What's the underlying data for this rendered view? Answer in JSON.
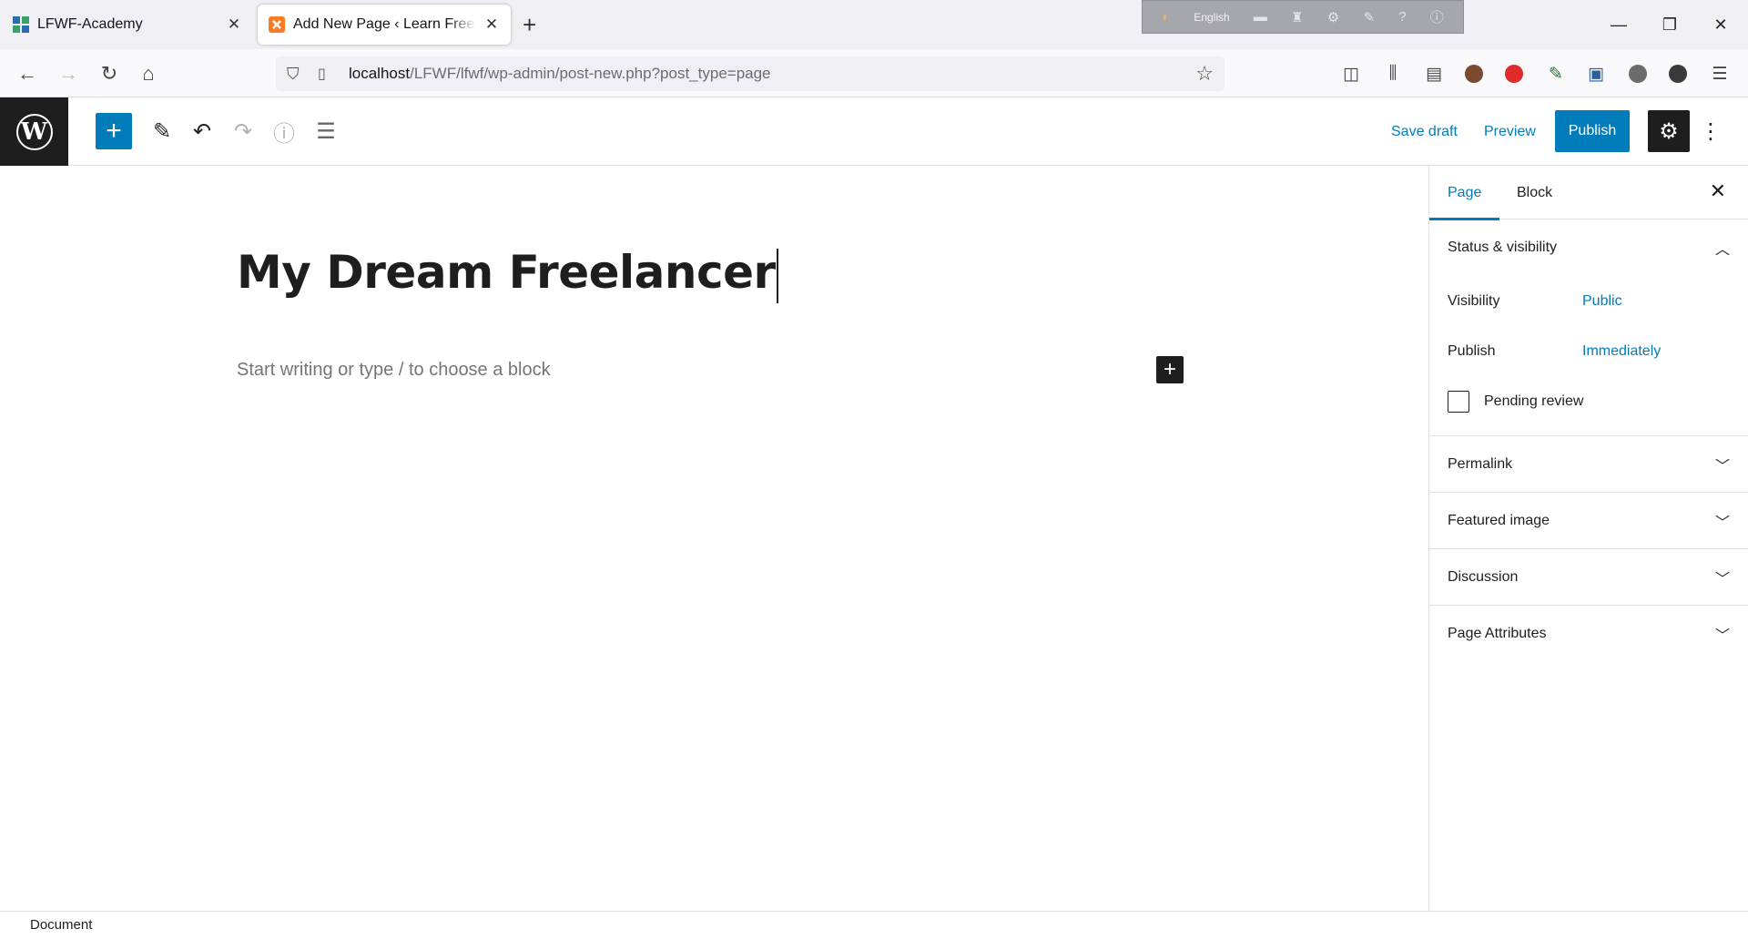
{
  "browser": {
    "tabs": [
      {
        "title": "LFWF-Academy",
        "icon": "lfwf-favicon",
        "active": false
      },
      {
        "title": "Add New Page ‹ Learn Freelanci",
        "icon": "xampp-favicon",
        "active": true
      }
    ],
    "new_tab_icon": "plus-icon",
    "ime_bar": {
      "language": "English"
    },
    "url": {
      "host": "localhost",
      "path": "/LFWF/lfwf/wp-admin/post-new.php?post_type=page"
    }
  },
  "editor": {
    "toolbar": {
      "save_draft": "Save draft",
      "preview": "Preview",
      "publish": "Publish"
    },
    "post_title": "My Dream Freelancer",
    "block_placeholder": "Start writing or type / to choose a block"
  },
  "sidebar": {
    "tabs": [
      "Page",
      "Block"
    ],
    "active_tab": "Page",
    "status_visibility": {
      "title": "Status & visibility",
      "visibility_label": "Visibility",
      "visibility_value": "Public",
      "publish_label": "Publish",
      "publish_value": "Immediately",
      "pending_review": "Pending review"
    },
    "panels": [
      "Permalink",
      "Featured image",
      "Discussion",
      "Page Attributes"
    ]
  },
  "footer": {
    "breadcrumb": "Document"
  },
  "colors": {
    "accent": "#007cba",
    "dark": "#1e1e1e"
  }
}
